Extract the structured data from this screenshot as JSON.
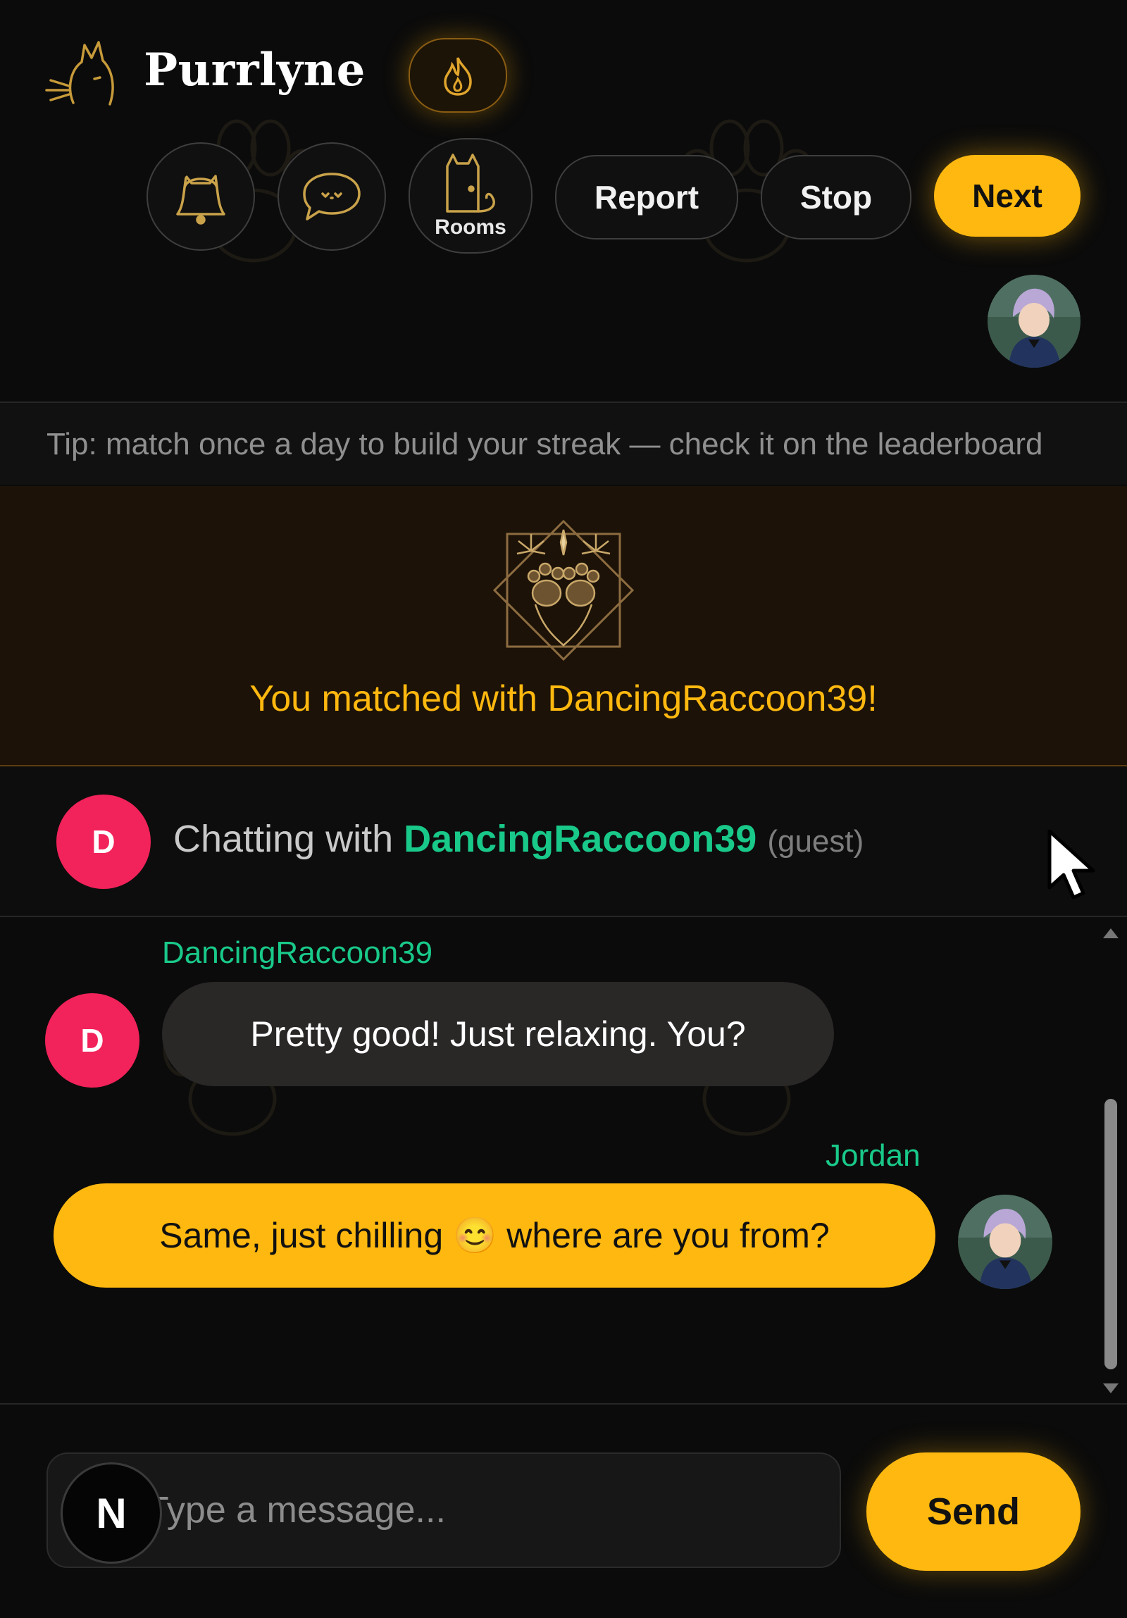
{
  "app": {
    "brand": "Purrlyne"
  },
  "toolbar": {
    "rooms_label": "Rooms",
    "report_label": "Report",
    "stop_label": "Stop",
    "next_label": "Next"
  },
  "tip": "Tip: match once a day to build your streak — check it on the leaderboard",
  "match": {
    "text": "You matched with DancingRaccoon39!"
  },
  "chat_header": {
    "avatar_initial": "D",
    "prefix": "Chatting with ",
    "partner": "DancingRaccoon39",
    "suffix": "(guest)"
  },
  "messages": [
    {
      "sender": "DancingRaccoon39",
      "avatar_initial": "D",
      "text": "Pretty good! Just relaxing. You?"
    },
    {
      "sender": "Jordan",
      "text": "Same, just chilling 😊 where are you from?"
    }
  ],
  "composer": {
    "placeholder": "Type a message...",
    "send_label": "Send",
    "badge": "N"
  },
  "colors": {
    "accent": "#ffb80f",
    "partner_name": "#19c98a",
    "avatar_d": "#f2225a",
    "background": "#0b0b0b"
  },
  "icons": [
    "cat-logo-icon",
    "streak-flame-icon",
    "bell-icon",
    "chat-bubble-icon",
    "rooms-door-icon",
    "paw-celebration-icon",
    "cursor-icon"
  ]
}
